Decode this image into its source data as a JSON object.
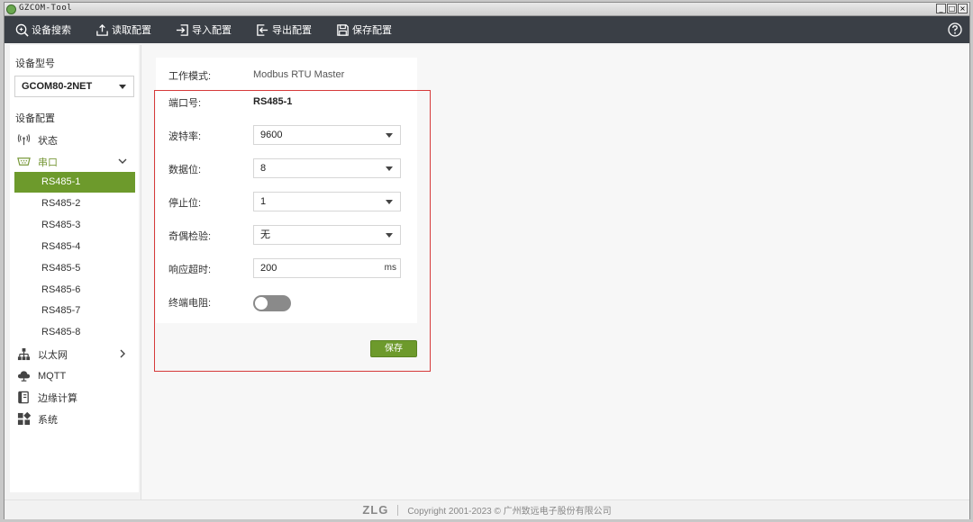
{
  "window": {
    "title": "GZCOM-Tool",
    "controls": [
      "_",
      "□",
      "×"
    ]
  },
  "toolbar": {
    "items": [
      {
        "label": "设备搜索",
        "icon": "search-icon"
      },
      {
        "label": "读取配置",
        "icon": "upload-icon"
      },
      {
        "label": "导入配置",
        "icon": "import-icon"
      },
      {
        "label": "导出配置",
        "icon": "export-icon"
      },
      {
        "label": "保存配置",
        "icon": "save-icon"
      }
    ],
    "help_icon": "help-icon"
  },
  "sidebar": {
    "device_model_label": "设备型号",
    "device_model_value": "GCOM80-2NET",
    "device_config_label": "设备配置",
    "nav": {
      "status": "状态",
      "serial": "串口",
      "ethernet": "以太网",
      "mqtt": "MQTT",
      "edge": "边缘计算",
      "system": "系统"
    },
    "serial_ports": [
      "RS485-1",
      "RS485-2",
      "RS485-3",
      "RS485-4",
      "RS485-5",
      "RS485-6",
      "RS485-7",
      "RS485-8"
    ],
    "active_port": "RS485-1",
    "accent_color": "#6d9a2c"
  },
  "form": {
    "work_mode_label": "工作模式:",
    "work_mode_value": "Modbus RTU Master",
    "port_label": "端口号:",
    "port_value": "RS485-1",
    "baud_label": "波特率:",
    "baud_value": "9600",
    "data_bits_label": "数据位:",
    "data_bits_value": "8",
    "stop_bits_label": "停止位:",
    "stop_bits_value": "1",
    "parity_label": "奇偶检验:",
    "parity_value": "无",
    "timeout_label": "响应超时:",
    "timeout_value": "200",
    "timeout_unit": "ms",
    "terminal_label": "终端电阻:",
    "terminal_enabled": false,
    "save_label": "保存"
  },
  "footer": {
    "logo": "ZLG",
    "copyright": "Copyright   2001-2023 © 广州致远电子股份有限公司"
  }
}
